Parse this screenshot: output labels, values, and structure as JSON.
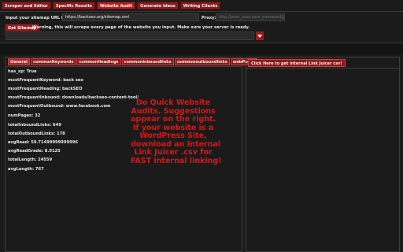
{
  "tabs": [
    {
      "label": "Scraper and Editor"
    },
    {
      "label": "Specific Results"
    },
    {
      "label": "Website Audit"
    },
    {
      "label": "Generate Ideas"
    },
    {
      "label": "Writing Clients"
    }
  ],
  "scraper": {
    "sitemap_label": "Input your sitemap URL here:",
    "sitemap_value": "https://backseo.org/sitemap.xml",
    "proxy_label": "Proxy:",
    "proxy_placeholder": "http://your_user:your_password@yo",
    "get_sitemap_label": "Get Sitemap",
    "warning": "Warning, this will scrape every page of the website you input. Make sure your server is ready.",
    "dropdown_value": ""
  },
  "audit": {
    "tabs": [
      {
        "label": "General"
      },
      {
        "label": "commonKeywords"
      },
      {
        "label": "commonHeadings"
      },
      {
        "label": "commoninboundlinks"
      },
      {
        "label": "commonoutboundlinks"
      },
      {
        "label": "webPages"
      }
    ],
    "rows": [
      {
        "text": "has_xp: True"
      },
      {
        "text": "mostFrequentKeyword: back seo"
      },
      {
        "text": "mostFrequentHeading: backSEO"
      },
      {
        "text": "mostFrequentInbound: downloads/backseo-content-tool/"
      },
      {
        "text": "mostFrequentOutbound: www.facebook.com"
      },
      {
        "text": "numPages: 32"
      },
      {
        "text": "totalInboundLinks: 649"
      },
      {
        "text": "totalOutboundLinks: 178"
      },
      {
        "text": "avgRead: 59.71499999999996"
      },
      {
        "text": "avgReadGrade: 8.9125"
      },
      {
        "text": "totalLength: 24559"
      },
      {
        "text": "avgLength: 767"
      }
    ],
    "promo_lines": [
      "Do Quick Website",
      "Audits. Suggestions",
      "appear on the right.",
      "If your website is a",
      "WordPress Site,",
      "download an Internal",
      "Link Juicer .csv for",
      "FAST internal linking!"
    ]
  },
  "juicer": {
    "button_label": "Click Here to get Internal Link Juicer csv!"
  },
  "colors": {
    "accent": "#9a1c1c",
    "background": "#1b1b1b",
    "promo_text": "#d41818"
  },
  "icons": {
    "dropdown_arrow": "caret-down-icon"
  }
}
